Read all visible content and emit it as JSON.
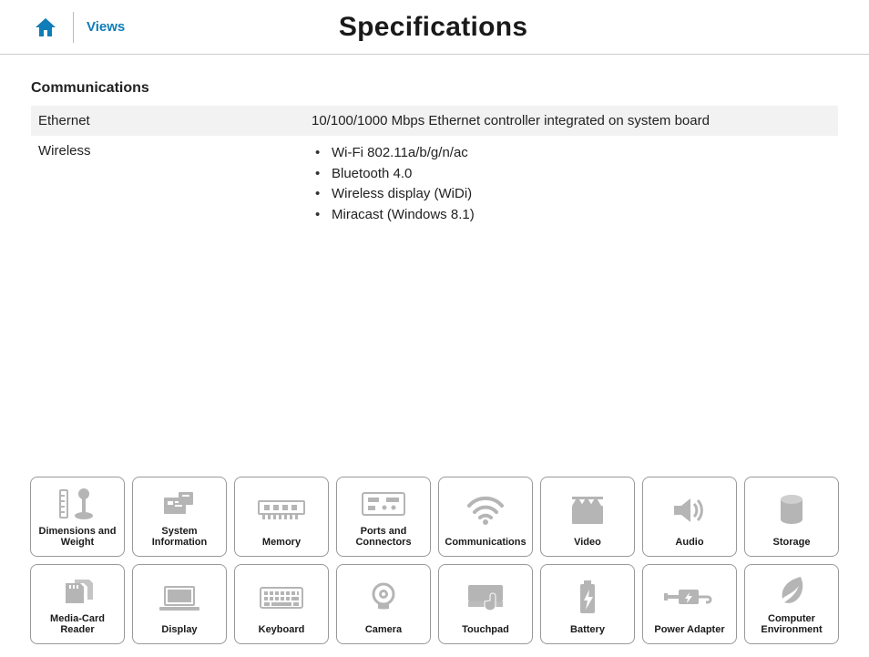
{
  "header": {
    "views_label": "Views",
    "title": "Specifications"
  },
  "section": {
    "heading": "Communications",
    "rows": [
      {
        "label": "Ethernet",
        "value": "10/100/1000 Mbps Ethernet controller integrated on system board"
      },
      {
        "label": "Wireless",
        "bullets": [
          "Wi-Fi 802.11a/b/g/n/ac",
          "Bluetooth 4.0",
          "Wireless display (WiDi)",
          "Miracast (Windows 8.1)"
        ]
      }
    ]
  },
  "nav": [
    {
      "label": "Dimensions and Weight",
      "icon": "dimensions-icon"
    },
    {
      "label": "System Information",
      "icon": "system-info-icon"
    },
    {
      "label": "Memory",
      "icon": "memory-icon"
    },
    {
      "label": "Ports and Connectors",
      "icon": "ports-icon"
    },
    {
      "label": "Communications",
      "icon": "communications-icon"
    },
    {
      "label": "Video",
      "icon": "video-icon"
    },
    {
      "label": "Audio",
      "icon": "audio-icon"
    },
    {
      "label": "Storage",
      "icon": "storage-icon"
    },
    {
      "label": "Media-Card Reader",
      "icon": "media-card-icon"
    },
    {
      "label": "Display",
      "icon": "display-icon"
    },
    {
      "label": "Keyboard",
      "icon": "keyboard-icon"
    },
    {
      "label": "Camera",
      "icon": "camera-icon"
    },
    {
      "label": "Touchpad",
      "icon": "touchpad-icon"
    },
    {
      "label": "Battery",
      "icon": "battery-icon"
    },
    {
      "label": "Power Adapter",
      "icon": "power-adapter-icon"
    },
    {
      "label": "Computer Environment",
      "icon": "environment-icon"
    }
  ]
}
